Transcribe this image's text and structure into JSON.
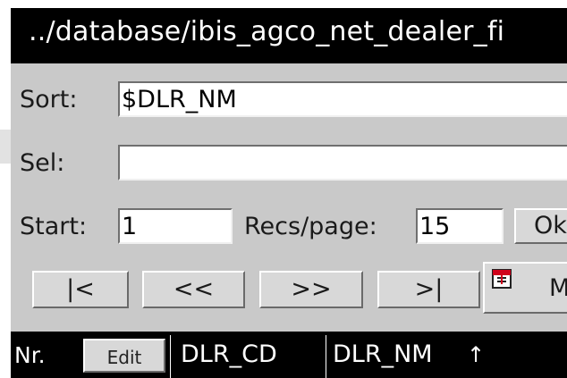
{
  "title": "../database/ibis_agco_net_dealer_fi",
  "sort": {
    "label": "Sort:",
    "value": "$DLR_NM"
  },
  "sel": {
    "label": "Sel:",
    "value": ""
  },
  "start": {
    "label": "Start:",
    "value": "1"
  },
  "recs": {
    "label": "Recs/page:",
    "value": "15"
  },
  "ok_label": "Ok",
  "nav": {
    "first": "|<",
    "prev": "<<",
    "next": ">>",
    "last": ">|",
    "extra": "M"
  },
  "columns": {
    "nr": "Nr.",
    "edit": "Edit",
    "dlr_cd": "DLR_CD",
    "dlr_nm": "DLR_NM",
    "sort_arrow": "↑"
  },
  "colors": {
    "title_bg": "#000000",
    "panel_bg": "#c9c9c9",
    "button_bg": "#d8d8d8",
    "icon_red": "#d0021b"
  }
}
